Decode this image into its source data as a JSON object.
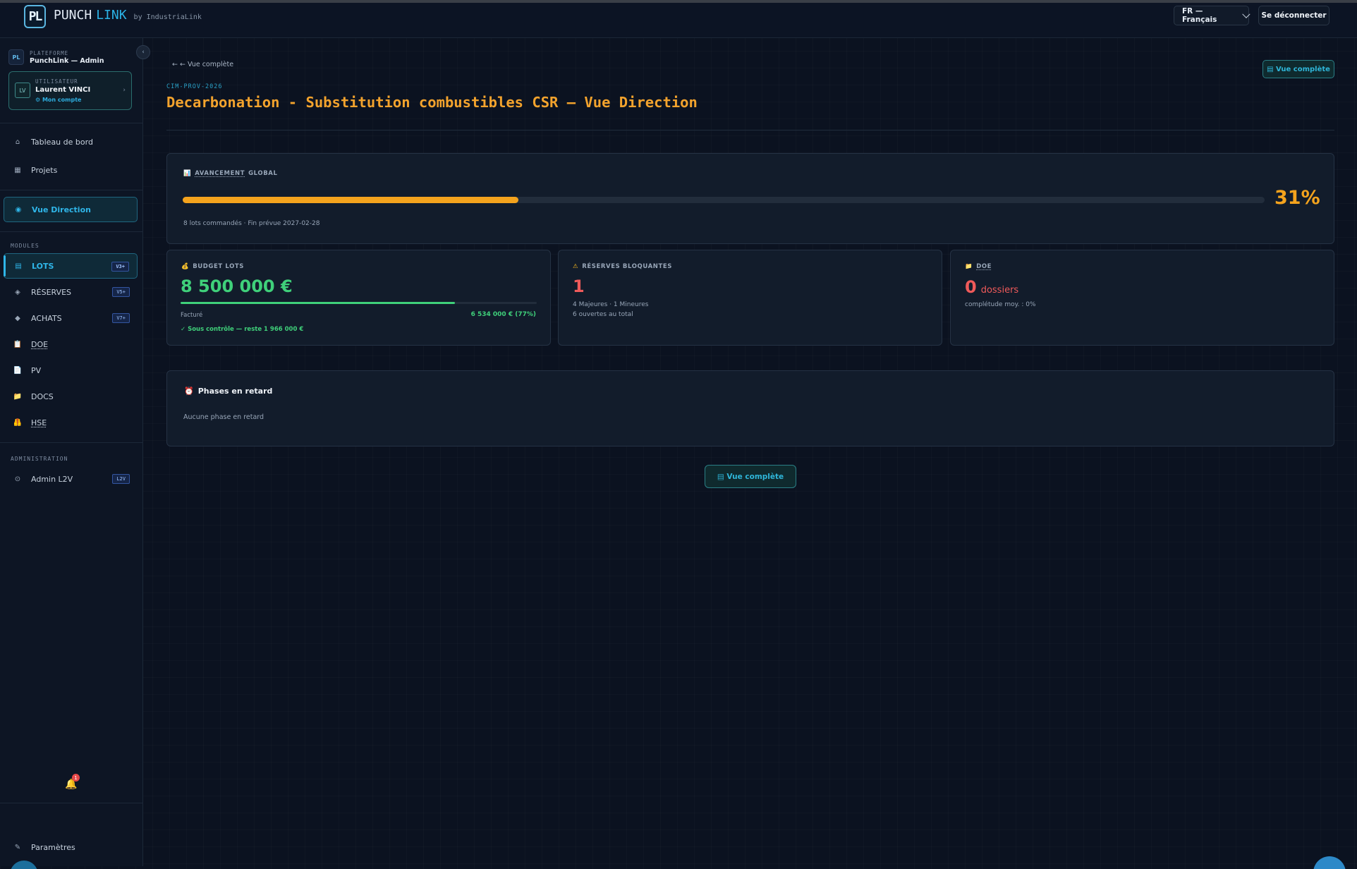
{
  "header": {
    "logo_text": "PL",
    "brand_word1": "PUNCH",
    "brand_word2": "LINK",
    "brand_by": "by IndustriaLink",
    "lang_label": "FR — Français",
    "logout_label": "Se déconnecter"
  },
  "sidebar": {
    "collapse_glyph": "‹",
    "platform": {
      "badge": "PL",
      "label": "PLATEFORME",
      "value": "PunchLink — Admin"
    },
    "user": {
      "initials": "LV",
      "label": "UTILISATEUR",
      "name": "Laurent VINCI",
      "account_link": "⚙ Mon compte",
      "arrow": "›"
    },
    "nav_main": [
      {
        "icon": "⌂",
        "label": "Tableau de bord"
      },
      {
        "icon": "▦",
        "label": "Projets"
      }
    ],
    "nav_direction": {
      "icon": "◉",
      "label": "Vue Direction"
    },
    "modules_label": "MODULES",
    "modules": [
      {
        "icon": "▤",
        "label": "LOTS",
        "tag": "V3+"
      },
      {
        "icon": "◈",
        "label": "RÉSERVES",
        "tag": "V5+"
      },
      {
        "icon": "◆",
        "label": "ACHATS",
        "tag": "V7+"
      },
      {
        "icon": "📋",
        "label": "DOE",
        "tag": ""
      },
      {
        "icon": "📄",
        "label": "PV",
        "tag": ""
      },
      {
        "icon": "📁",
        "label": "DOCS",
        "tag": ""
      },
      {
        "icon": "🦺",
        "label": "HSE",
        "tag": ""
      }
    ],
    "admin_label": "ADMINISTRATION",
    "admin_item": {
      "icon": "⊙",
      "label": "Admin L2V",
      "tag": "L2V"
    },
    "notification_count": "1",
    "settings": {
      "icon": "✎",
      "label": "Paramètres"
    }
  },
  "main": {
    "back_link": "← ← Vue complète",
    "top_button": "▤ Vue complète",
    "project_code": "CIM-PROV-2026",
    "title": "Decarbonation - Substitution combustibles CSR — Vue Direction",
    "progress": {
      "icon": "📊",
      "label_part1": "AVANCEMENT",
      "label_part2": "GLOBAL",
      "percent_value": 31,
      "percent_label": "31%",
      "meta": "8 lots commandés · Fin prévue 2027-02-28"
    },
    "budget": {
      "icon": "💰",
      "label": "BUDGET LOTS",
      "amount": "8 500 000 €",
      "billed_fraction": 0.77,
      "billed_label": "Facturé",
      "billed_value": "6 534 000 € (77%)",
      "status": "✓ Sous contrôle — reste 1 966 000 €"
    },
    "reserves": {
      "icon": "⚠",
      "label": "RÉSERVES BLOQUANTES",
      "count": "1",
      "line1": "4 Majeures · 1 Mineures",
      "line2": "6 ouvertes au total"
    },
    "doe": {
      "icon": "📁",
      "label": "DOE",
      "count": "0",
      "unit": "dossiers",
      "meta": "complétude moy. : 0%"
    },
    "phases": {
      "icon": "⏰",
      "title": "Phases en retard",
      "empty": "Aucune phase en retard"
    },
    "bottom_button": "▤ Vue complète"
  },
  "colors": {
    "accent": "#2fb6e9",
    "title": "#f3a32d",
    "progress": "#f4a31d",
    "budget": "#3fd07a",
    "danger": "#ef5a5a"
  }
}
